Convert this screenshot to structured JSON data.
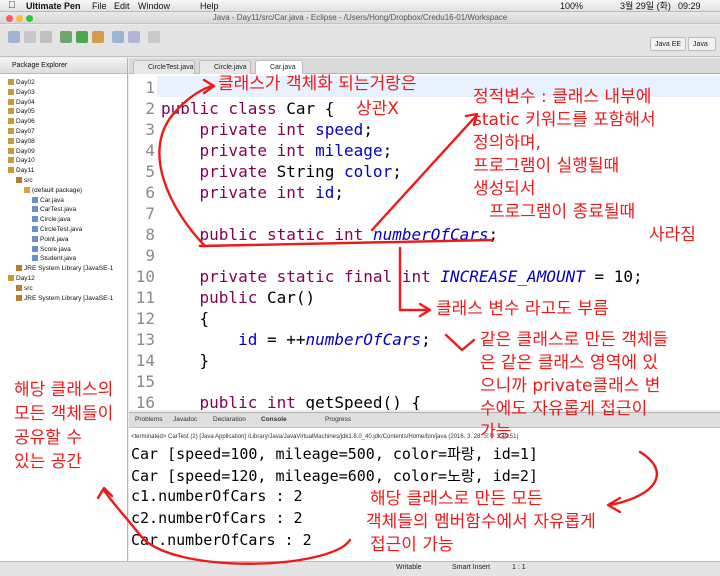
{
  "menubar": {
    "app": "Ultimate Pen",
    "items": [
      "File",
      "Edit",
      "Window",
      "Help"
    ],
    "status_right": [
      "100%",
      "3월 29일 (화)",
      "09:29"
    ]
  },
  "window": {
    "title": "Java - Day11/src/Car.java - Eclipse - /Users/Hong/Dropbox/Credu16-01/Workspace"
  },
  "perspectives": [
    "Java EE",
    "Java"
  ],
  "package_explorer": {
    "title": "Package Explorer",
    "items": [
      {
        "label": "Day02",
        "depth": 0
      },
      {
        "label": "Day03",
        "depth": 0
      },
      {
        "label": "Day04",
        "depth": 0
      },
      {
        "label": "Day05",
        "depth": 0
      },
      {
        "label": "Day06",
        "depth": 0
      },
      {
        "label": "Day07",
        "depth": 0
      },
      {
        "label": "Day08",
        "depth": 0
      },
      {
        "label": "Day09",
        "depth": 0
      },
      {
        "label": "Day10",
        "depth": 0
      },
      {
        "label": "Day11",
        "depth": 0
      },
      {
        "label": "src",
        "depth": 1
      },
      {
        "label": "(default package)",
        "depth": 2
      },
      {
        "label": "Car.java",
        "depth": 3
      },
      {
        "label": "CarTest.java",
        "depth": 3
      },
      {
        "label": "Circle.java",
        "depth": 3
      },
      {
        "label": "CircleTest.java",
        "depth": 3
      },
      {
        "label": "Point.java",
        "depth": 3
      },
      {
        "label": "Score.java",
        "depth": 3
      },
      {
        "label": "Student.java",
        "depth": 3
      },
      {
        "label": "JRE System Library [JavaSE-1",
        "depth": 1
      },
      {
        "label": "Day12",
        "depth": 0
      },
      {
        "label": "src",
        "depth": 1
      },
      {
        "label": "JRE System Library [JavaSE-1",
        "depth": 1
      }
    ]
  },
  "editor": {
    "tabs": [
      "CircleTest.java",
      "Circle.java",
      "Car.java"
    ],
    "active_tab": "Car.java",
    "line_numbers": [
      "1",
      "2",
      "3",
      "4",
      "5",
      "6",
      "7",
      "8",
      "9",
      "10",
      "11",
      "12",
      "13",
      "14",
      "15",
      "16"
    ]
  },
  "console": {
    "tabs": [
      "Problems",
      "Javadoc",
      "Declaration",
      "Console",
      "Progress"
    ],
    "terminated": "<terminated> CarTest (2) [Java Application] /Library/Java/JavaVirtualMachines/jdk1.8.0_40.jdk/Contents/Home/bin/java (2016. 3. 28. 오후 3:49:51)",
    "lines": [
      "Car [speed=100, mileage=500, color=파랑, id=1]",
      "Car [speed=120, mileage=600, color=노랑, id=2]",
      "c1.numberOfCars : 2",
      "c2.numberOfCars : 2",
      "Car.numberOfCars : 2"
    ]
  },
  "statusbar": [
    "Writable",
    "Smart Insert",
    "1 : 1"
  ],
  "annotations": {
    "a1": "클래스가 객체화 되는거랑은",
    "a1b": "상관X",
    "a2": [
      "정적변수 : 클래스 내부에",
      "static 키워드를 포함해서",
      "정의하며,",
      "프로그램이 실행될때",
      "생성되서",
      "프로그램이 종료될때",
      "사라짐"
    ],
    "a3": "클래스 변수 라고도 부름",
    "a4": [
      "같은 클래스로 만든 객체들",
      "은 같은 클래스 영역에 있",
      "으니까 private클래스 변",
      "수에도 자유롭게 접근이",
      "가능"
    ],
    "a5": [
      "해당 클래스의",
      "모든 객체들이",
      "공유할 수",
      "있는 공간"
    ],
    "a6": [
      "해당 클래스로 만든 모든",
      "객체들의 멤버함수에서 자유롭게",
      "접근이 가능"
    ]
  },
  "colors": {
    "annotation": "#ee1a1a",
    "keyword": "#7f0055",
    "field": "#0000c0"
  }
}
